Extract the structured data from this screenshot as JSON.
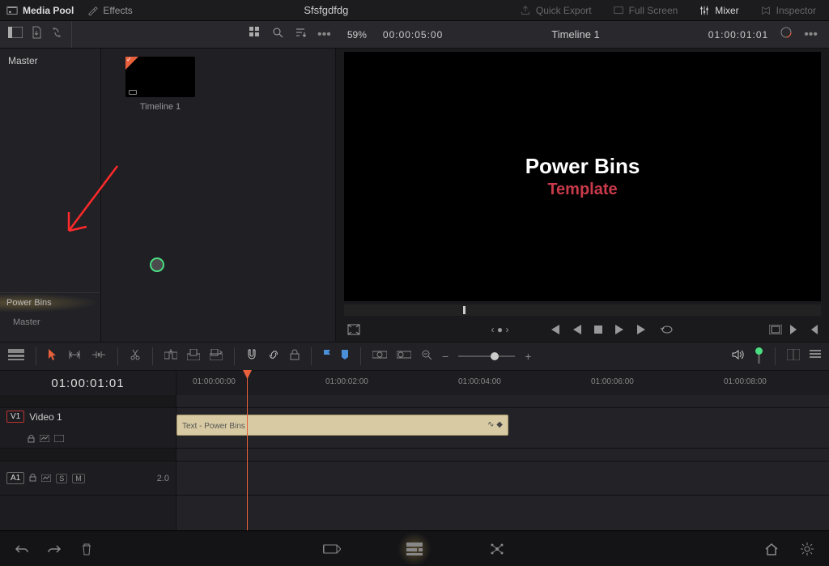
{
  "topbar": {
    "media_pool": "Media Pool",
    "effects": "Effects",
    "project": "Sfsfgdfdg",
    "quick_export": "Quick Export",
    "full_screen": "Full Screen",
    "mixer": "Mixer",
    "inspector": "Inspector"
  },
  "toolbar": {
    "zoom": "59%",
    "tc_left": "00:00:05:00",
    "timeline_name": "Timeline 1",
    "tc_right": "01:00:01:01"
  },
  "sidebar": {
    "master": "Master",
    "power_bins": "Power Bins",
    "pb_master": "Master"
  },
  "media": {
    "clip1": "Timeline 1"
  },
  "viewer": {
    "line1": "Power Bins",
    "line2": "Template"
  },
  "timeline": {
    "tc": "01:00:01:01",
    "ticks": [
      "01:00:00:00",
      "01:00:02:00",
      "01:00:04:00",
      "01:00:06:00",
      "01:00:08:00"
    ],
    "v1": {
      "tag": "V1",
      "name": "Video 1"
    },
    "a1": {
      "tag": "A1",
      "val": "2.0"
    },
    "clip1": "Text - Power Bins"
  }
}
